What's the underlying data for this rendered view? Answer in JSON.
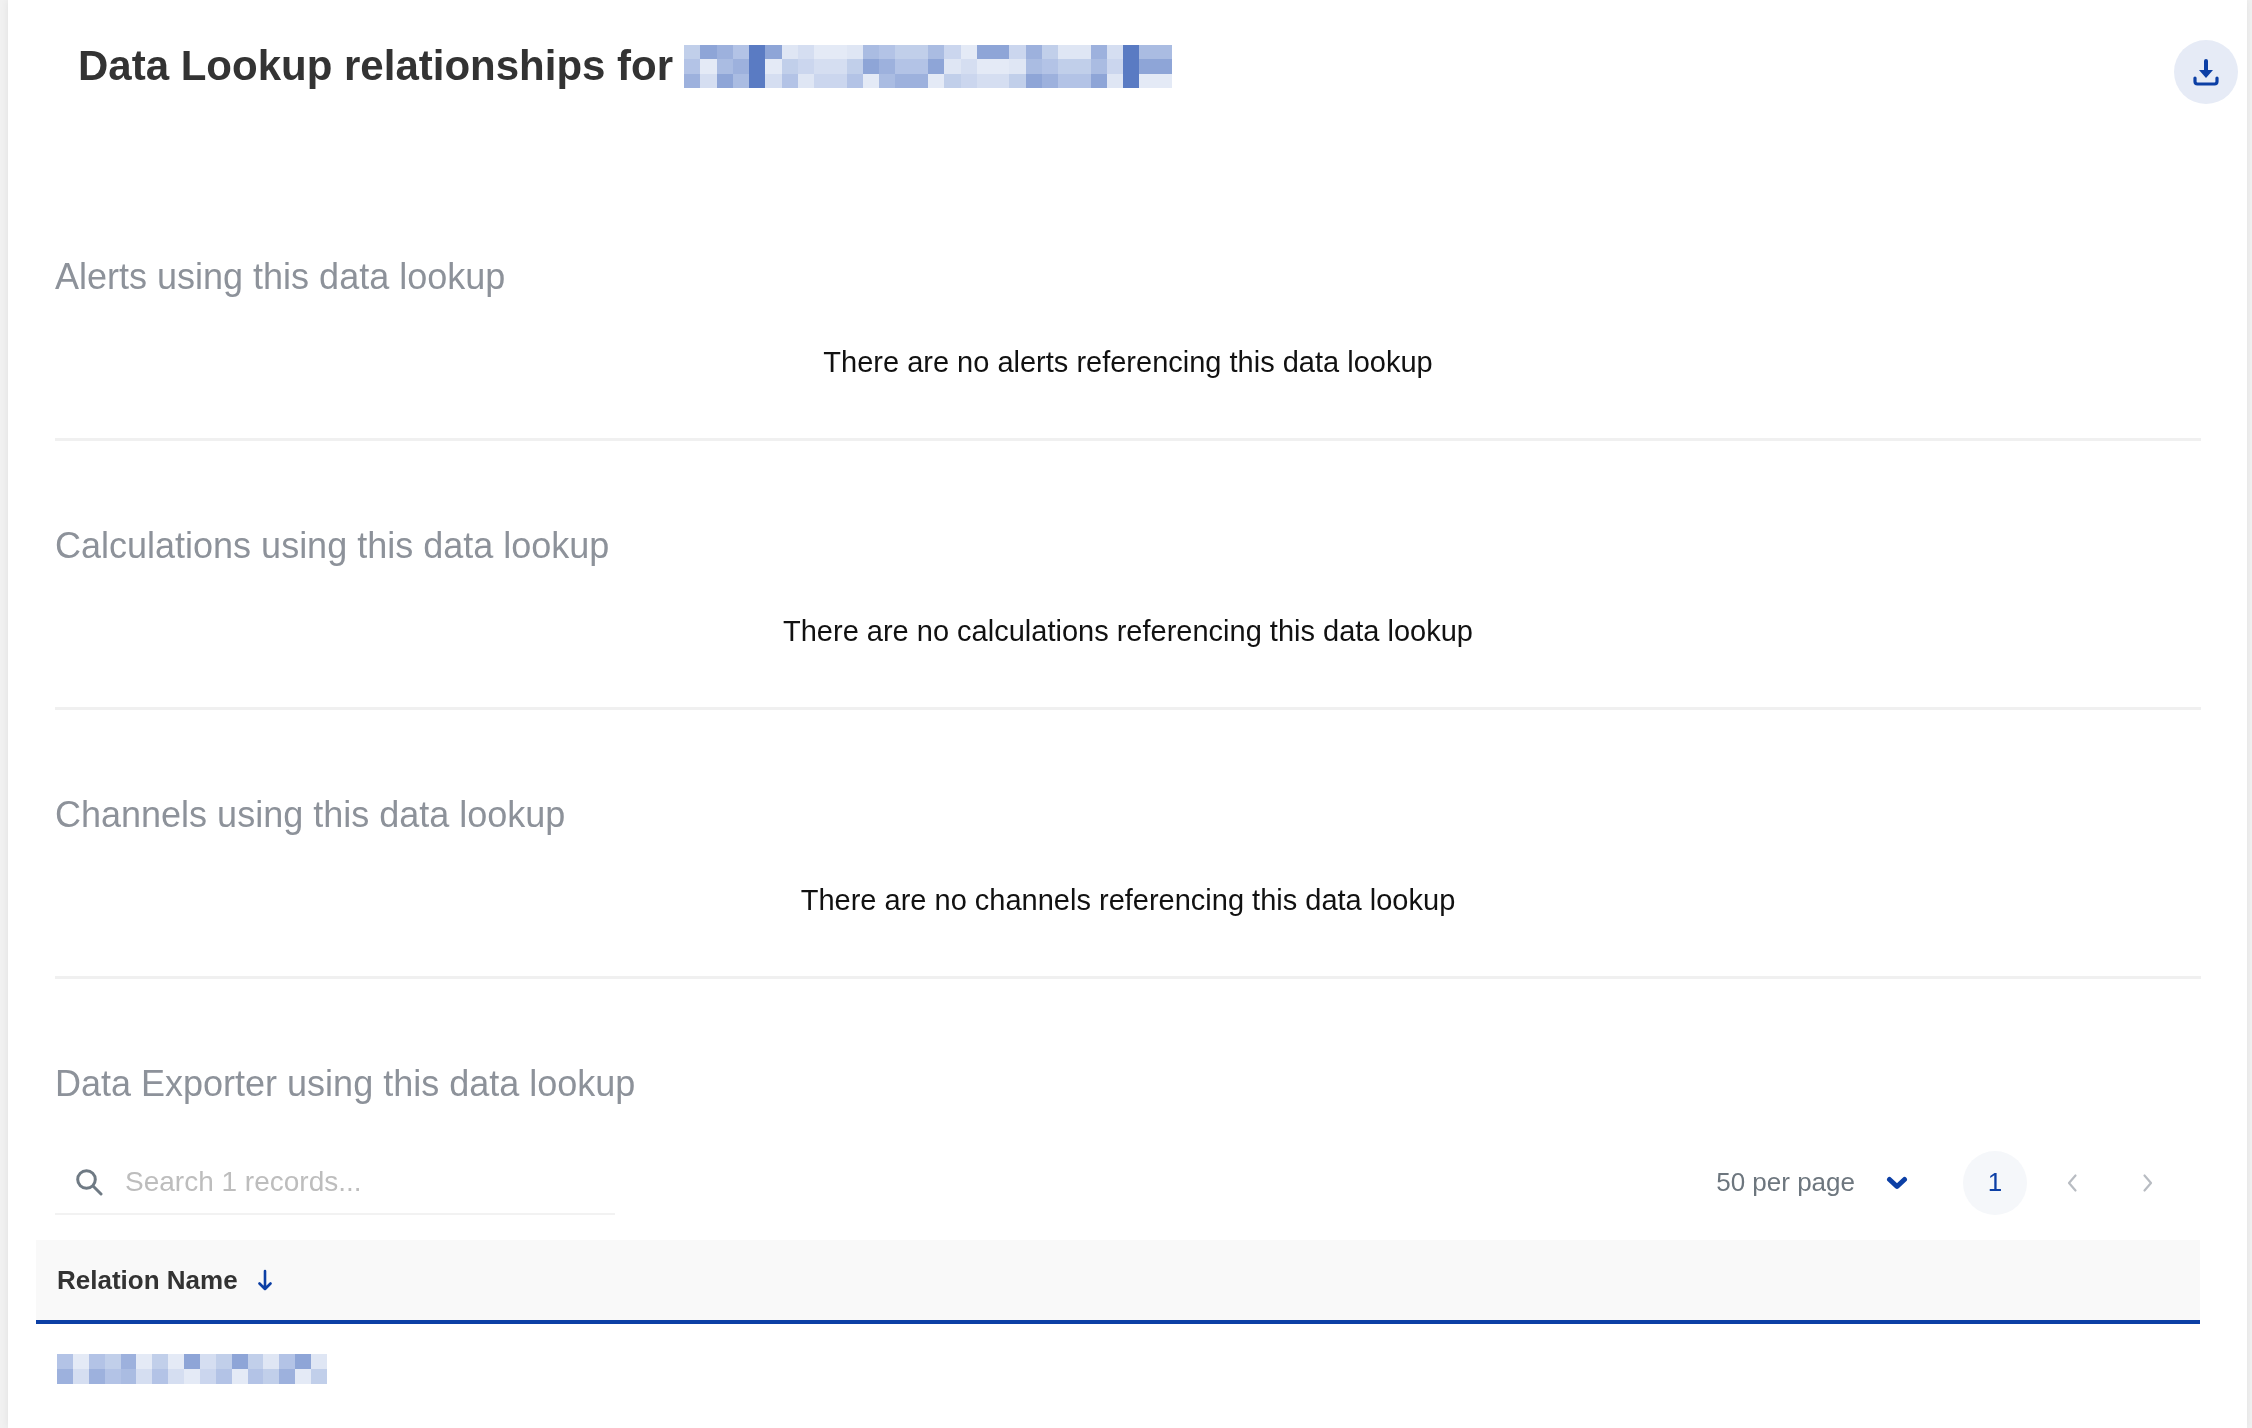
{
  "header": {
    "title": "Data Lookup relationships for",
    "subject_redacted": true
  },
  "sections": [
    {
      "kind": "empty",
      "heading": "Alerts using this data lookup",
      "message": "There are no alerts referencing this data lookup"
    },
    {
      "kind": "empty",
      "heading": "Calculations using this data lookup",
      "message": "There are no calculations referencing this data lookup"
    },
    {
      "kind": "empty",
      "heading": "Channels using this data lookup",
      "message": "There are no channels referencing this data lookup"
    },
    {
      "kind": "table",
      "heading": "Data Exporter using this data lookup",
      "search": {
        "placeholder": "Search 1 records..."
      },
      "pagination": {
        "per_page": "50 per page",
        "pages": [
          {
            "label": "1",
            "selected": true
          }
        ],
        "previous": {
          "disabled": true
        },
        "next": {
          "disabled": true
        }
      },
      "table": {
        "columns": [
          {
            "label": "Relation Name",
            "sorted": true
          }
        ],
        "rows": [
          {
            "redacted": true
          }
        ]
      }
    }
  ]
}
